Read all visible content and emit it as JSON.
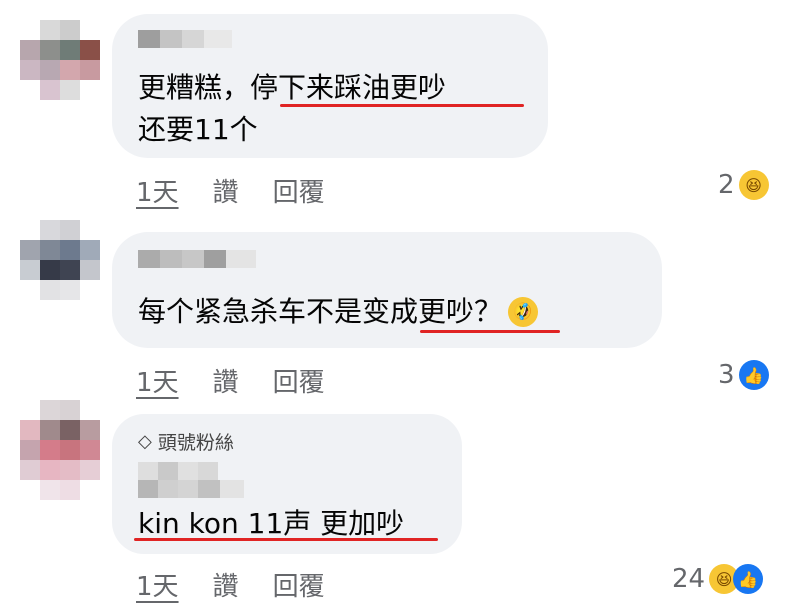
{
  "comments": [
    {
      "lines": [
        "更糟糕，停下来踩油更吵",
        "还要11个"
      ],
      "actions": [
        "1天",
        "讚",
        "回覆"
      ],
      "reaction_count": "2",
      "reaction_icons": [
        "laughing-emoji-icon"
      ]
    },
    {
      "lines": [
        "每个紧急杀车不是变成更吵？"
      ],
      "trailing_emoji": "rolling-on-floor-laughing-emoji-icon",
      "actions": [
        "1天",
        "讚",
        "回覆"
      ],
      "reaction_count": "3",
      "reaction_icons": [
        "like-icon"
      ]
    },
    {
      "badge": "頭號粉絲",
      "lines": [
        "kin kon 11声 更加吵"
      ],
      "actions": [
        "1天",
        "讚",
        "回覆"
      ],
      "reaction_count": "24",
      "reaction_icons": [
        "laughing-emoji-icon",
        "like-icon"
      ]
    }
  ],
  "colors": {
    "bubble": "#f0f2f5",
    "underline": "#e02424",
    "meta": "#65676b",
    "like": "#1877f2",
    "emoji": "#f7c634"
  }
}
